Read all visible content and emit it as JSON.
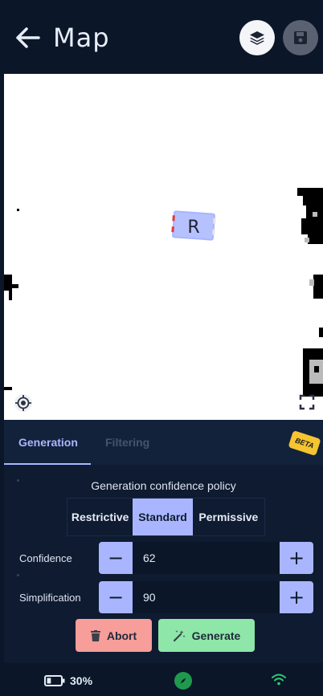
{
  "header": {
    "title": "Map",
    "back_icon": "arrow-left-icon",
    "layers_icon": "layers-icon",
    "save_icon": "floppy-disk-icon"
  },
  "map": {
    "robot_label": "R",
    "locate_icon": "crosshair-icon",
    "fullscreen_icon": "fullscreen-icon"
  },
  "panel": {
    "tabs": [
      {
        "label": "Generation",
        "active": true
      },
      {
        "label": "Filtering",
        "active": false
      }
    ],
    "beta_badge": "BETA",
    "policy_title": "Generation confidence policy",
    "policy_options": [
      {
        "label": "Restrictive",
        "active": false
      },
      {
        "label": "Standard",
        "active": true
      },
      {
        "label": "Permissive",
        "active": false
      }
    ],
    "confidence": {
      "label": "Confidence",
      "value": "62",
      "minus": "−",
      "plus": "+"
    },
    "simplification": {
      "label": "Simplification",
      "value": "90",
      "minus": "−",
      "plus": "+"
    },
    "abort_label": "Abort",
    "generate_label": "Generate"
  },
  "status_bar": {
    "battery": "30%",
    "battery_level": 0.3,
    "battery_icon": "battery-icon",
    "compass_icon": "compass-icon",
    "wifi_icon": "wifi-icon"
  },
  "colors": {
    "background": "#0b1629",
    "accent": "#a9b6ff",
    "abort": "#f79d9a",
    "generate": "#8ee6a8",
    "beta": "#f5c531",
    "compass": "#1f9a4c",
    "wifi": "#2ecc71"
  }
}
